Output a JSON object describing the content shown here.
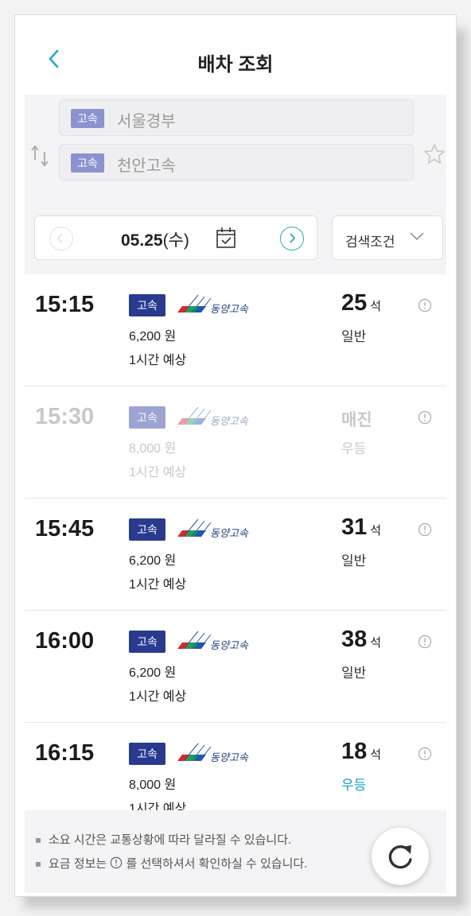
{
  "header": {
    "title": "배차 조회"
  },
  "route": {
    "origin_tag": "고속",
    "origin": "서울경부",
    "destination_tag": "고속",
    "destination": "천안고속"
  },
  "date_bar": {
    "date": "05.25",
    "weekday": "(수)",
    "filter_label": "검색조건"
  },
  "buses": [
    {
      "time": "15:15",
      "tag": "고속",
      "company": "동양고속",
      "fare": "6,200 원",
      "duration": "1시간 예상",
      "seats": "25",
      "seat_unit": "석",
      "grade": "일반",
      "status": "available"
    },
    {
      "time": "15:30",
      "tag": "고속",
      "company": "동양고속",
      "fare": "8,000 원",
      "duration": "1시간 예상",
      "seats_text": "매진",
      "grade": "우등",
      "status": "soldout"
    },
    {
      "time": "15:45",
      "tag": "고속",
      "company": "동양고속",
      "fare": "6,200 원",
      "duration": "1시간 예상",
      "seats": "31",
      "seat_unit": "석",
      "grade": "일반",
      "status": "available"
    },
    {
      "time": "16:00",
      "tag": "고속",
      "company": "동양고속",
      "fare": "6,200 원",
      "duration": "1시간 예상",
      "seats": "38",
      "seat_unit": "석",
      "grade": "일반",
      "status": "available"
    },
    {
      "time": "16:15",
      "tag": "고속",
      "company": "동양고속",
      "fare": "8,000 원",
      "duration": "1시간 예상",
      "seats": "18",
      "seat_unit": "석",
      "grade": "우등",
      "status": "available"
    }
  ],
  "notices": {
    "line1": "소요 시간은 교통상황에 따라 달라질 수 있습니다.",
    "line2_pre": "요금 정보는",
    "line2_post": "를 선택하셔서 확인하실 수 있습니다."
  },
  "colors": {
    "accent": "#2aa8c2",
    "tag_bg": "#2a3a8f",
    "premium_text": "#16a0bb"
  },
  "icons": [
    "back-icon",
    "swap-icon",
    "star-icon",
    "prev-date-icon",
    "calendar-icon",
    "next-date-icon",
    "chevron-down-icon",
    "info-icon",
    "refresh-icon"
  ]
}
